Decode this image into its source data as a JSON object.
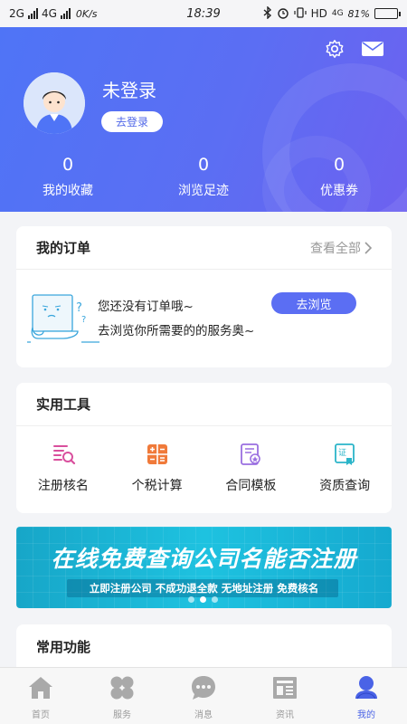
{
  "status_bar": {
    "network_1": "2G",
    "network_2": "4G",
    "speed": "0K/s",
    "time": "18:39",
    "hd": "HD",
    "lte": "4G",
    "battery": "81%",
    "battery_level": 0.81
  },
  "header": {
    "username": "未登录",
    "login_label": "去登录",
    "stats": [
      {
        "value": "0",
        "label": "我的收藏"
      },
      {
        "value": "0",
        "label": "浏览足迹"
      },
      {
        "value": "0",
        "label": "优惠券"
      }
    ]
  },
  "orders": {
    "title": "我的订单",
    "more_label": "查看全部",
    "empty_text": "您还没有订单哦~",
    "empty_hint": "去浏览你所需要的的服务奥~",
    "browse_label": "去浏览"
  },
  "tools": {
    "title": "实用工具",
    "items": [
      {
        "label": "注册核名",
        "icon": "name-search-icon",
        "color": "#d94f9d"
      },
      {
        "label": "个税计算",
        "icon": "calculator-icon",
        "color": "#f07a3a"
      },
      {
        "label": "合同模板",
        "icon": "contract-icon",
        "color": "#9a6fe0"
      },
      {
        "label": "资质查询",
        "icon": "certificate-icon",
        "color": "#2bb5c9"
      }
    ]
  },
  "banner": {
    "headline": "在线免费查询公司名能否注册",
    "subline": "立即注册公司  不成功退全款  无地址注册  免费核名"
  },
  "common": {
    "title": "常用功能"
  },
  "tabbar": {
    "items": [
      {
        "label": "首页",
        "icon": "home-icon"
      },
      {
        "label": "服务",
        "icon": "service-icon"
      },
      {
        "label": "消息",
        "icon": "message-icon"
      },
      {
        "label": "资讯",
        "icon": "news-icon"
      },
      {
        "label": "我的",
        "icon": "profile-icon",
        "active": true
      }
    ],
    "active_color": "#4a63e6"
  }
}
